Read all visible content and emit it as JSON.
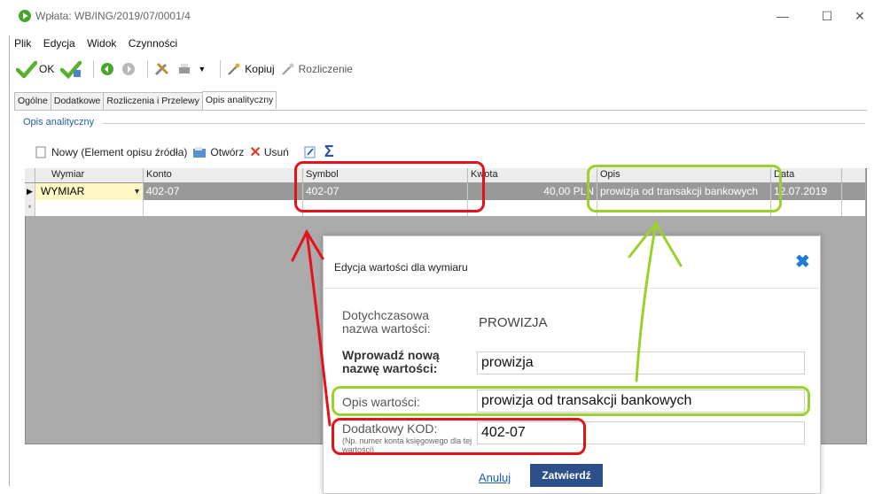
{
  "window": {
    "title": "Wpłata: WB/ING/2019/07/0001/4",
    "minimize": "—",
    "maximize": "☐",
    "close": "✕"
  },
  "menu": [
    "Plik",
    "Edycja",
    "Widok",
    "Czynności"
  ],
  "toolbar": {
    "ok_label": "OK",
    "copy_label": "Kopiuj",
    "settle_label": "Rozliczenie"
  },
  "tabs": [
    "Ogólne",
    "Dodatkowe",
    "Rozliczenia i Przelewy",
    "Opis analityczny"
  ],
  "group_title": "Opis analityczny",
  "subtoolbar": {
    "new_label": "Nowy (Element opisu źródła)",
    "open_label": "Otwórz",
    "delete_label": "Usuń"
  },
  "grid": {
    "columns": [
      "Wymiar",
      "Konto",
      "Symbol",
      "Kwota",
      "Opis",
      "Data"
    ],
    "row": {
      "wymiar": "WYMIAR",
      "konto": "402-07",
      "symbol": "402-07",
      "kwota": "40,00 PLN",
      "opis": "prowizja od transakcji bankowych",
      "data": "12.07.2019"
    },
    "new_row_marker": "*"
  },
  "dialog": {
    "title": "Edycja wartości dla wymiaru",
    "current_name_label": "Dotychczasowa nazwa wartości:",
    "current_name_value": "PROWIZJA",
    "new_name_label": "Wprowadź nową nazwę wartości:",
    "new_name_value": "prowizja",
    "desc_label": "Opis wartości:",
    "desc_value": "prowizja od transakcji bankowych",
    "code_label": "Dodatkowy KOD:",
    "code_hint": "(Np. numer konta księgowego dla tej wartości)",
    "code_value": "402-07",
    "cancel_label": "Anuluj",
    "confirm_label": "Zatwierdź"
  },
  "colors": {
    "red_annotation": "#e3121b",
    "green_annotation": "#9bd12b",
    "primary": "#2d4f8a"
  }
}
